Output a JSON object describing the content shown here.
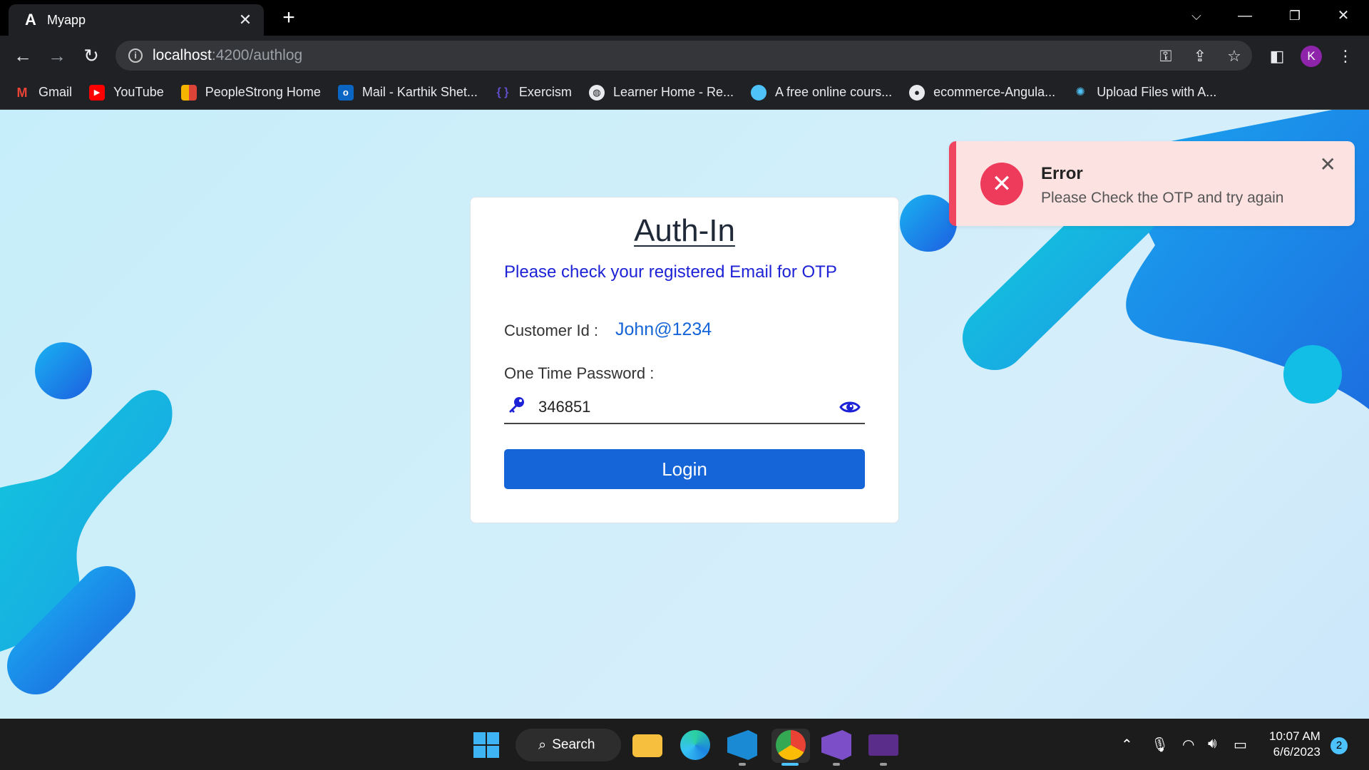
{
  "browser": {
    "tab": {
      "title": "Myapp",
      "favicon": "angular-icon"
    },
    "address": {
      "host": "localhost",
      "path": ":4200/authlog"
    },
    "profile_initial": "K",
    "bookmarks": [
      {
        "label": "Gmail",
        "icon": "gmail-icon",
        "color": "#ea4335"
      },
      {
        "label": "YouTube",
        "icon": "youtube-icon",
        "color": "#ff0000"
      },
      {
        "label": "PeopleStrong Home",
        "icon": "peoplestrong-icon",
        "color": "#f4b400"
      },
      {
        "label": "Mail - Karthik Shet...",
        "icon": "outlook-icon",
        "color": "#0a66c2"
      },
      {
        "label": "Exercism",
        "icon": "exercism-icon",
        "color": "#604fcd"
      },
      {
        "label": "Learner Home - Re...",
        "icon": "globe-icon",
        "color": "#e8eaed"
      },
      {
        "label": "A free online cours...",
        "icon": "course-icon",
        "color": "#4fc3f7"
      },
      {
        "label": "ecommerce-Angula...",
        "icon": "github-icon",
        "color": "#e8eaed"
      },
      {
        "label": "Upload Files with A...",
        "icon": "upload-icon",
        "color": "#4fc3f7"
      }
    ]
  },
  "auth": {
    "heading": "Auth-In",
    "notice": "Please check your registered Email for OTP",
    "customer_label": "Customer Id :",
    "customer_value": "John@1234",
    "otp_label": "One Time Password :",
    "otp_value": "346851",
    "login_label": "Login"
  },
  "toast": {
    "title": "Error",
    "message": "Please Check the OTP and try again",
    "accent": "#f0455e"
  },
  "taskbar": {
    "search_label": "Search",
    "time": "10:07 AM",
    "date": "6/6/2023",
    "notification_count": "2"
  }
}
